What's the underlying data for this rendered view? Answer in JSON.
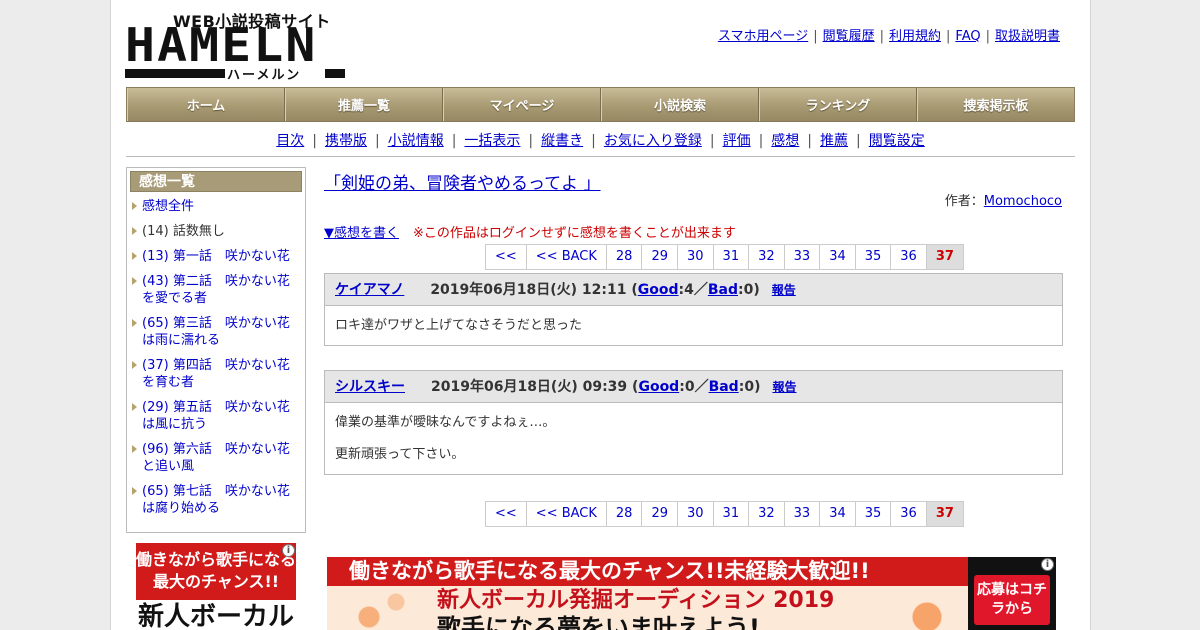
{
  "logo": {
    "tagline": "WEB小説投稿サイト",
    "wordmark": "HAMELN",
    "kana": "ハーメルン"
  },
  "toplinks": [
    "スマホ用ページ",
    "閲覧履歴",
    "利用規約",
    "FAQ",
    "取扱説明書"
  ],
  "mainnav": [
    "ホーム",
    "推薦一覧",
    "マイページ",
    "小説検索",
    "ランキング",
    "捜索掲示板"
  ],
  "subnav": [
    "目次",
    "携帯版",
    "小説情報",
    "一括表示",
    "縦書き",
    "お気に入り登録",
    "評価",
    "感想",
    "推薦",
    "閲覧設定"
  ],
  "sidebar": {
    "title": "感想一覧",
    "items": [
      {
        "label": "感想全件",
        "link": true
      },
      {
        "label": "(14) 話数無し",
        "link": false
      },
      {
        "label": "(13) 第一話　咲かない花",
        "link": true
      },
      {
        "label": "(43) 第二話　咲かない花を愛でる者",
        "link": true
      },
      {
        "label": "(65) 第三話　咲かない花は雨に濡れる",
        "link": true
      },
      {
        "label": "(37) 第四話　咲かない花を育む者",
        "link": true
      },
      {
        "label": "(29) 第五話　咲かない花は風に抗う",
        "link": true
      },
      {
        "label": "(96) 第六話　咲かない花と追い風",
        "link": true
      },
      {
        "label": "(65) 第七話　咲かない花は腐り始める",
        "link": true
      }
    ]
  },
  "work": {
    "title": "「剣姫の弟、冒険者やめるってよ 」",
    "author_label": "作者：",
    "author": "Momochoco",
    "write_link": "▼感想を書く",
    "warning": "※この作品はログインせずに感想を書くことが出来ます"
  },
  "pager": {
    "first": "<<",
    "back": "<< BACK",
    "pages": [
      "28",
      "29",
      "30",
      "31",
      "32",
      "33",
      "34",
      "35",
      "36"
    ],
    "current": "37"
  },
  "comments": [
    {
      "user": "ケイアマノ",
      "date": "2019年06月18日(火) 12:11",
      "good_label": "Good",
      "good": "4",
      "bad_label": "Bad",
      "bad": "0",
      "report": "報告",
      "body": [
        "ロキ達がワザと上げてなさそうだと思った"
      ]
    },
    {
      "user": "シルスキー",
      "date": "2019年06月18日(火) 09:39",
      "good_label": "Good",
      "good": "0",
      "bad_label": "Bad",
      "bad": "0",
      "report": "報告",
      "body": [
        "偉業の基準が曖昧なんですよねぇ…。",
        "更新頑張って下さい。"
      ]
    }
  ],
  "ads": {
    "side_top": "働きながら歌手になる最大のチャンス!!",
    "side_bottom": "新人ボーカル",
    "main_band": "働きながら歌手になる最大のチャンス!!未経験大歓迎!!",
    "main_sub": "新人ボーカル発掘オーディション 2019",
    "main_sub2": "歌手になる夢をいま叶えよう!",
    "main_cta": "応募はコチラから",
    "info_icon": "i"
  },
  "colors": {
    "nav_gold": "#a89a73",
    "link": "#0000cc",
    "warning": "#cc0000",
    "ad_red": "#d11b1b"
  }
}
